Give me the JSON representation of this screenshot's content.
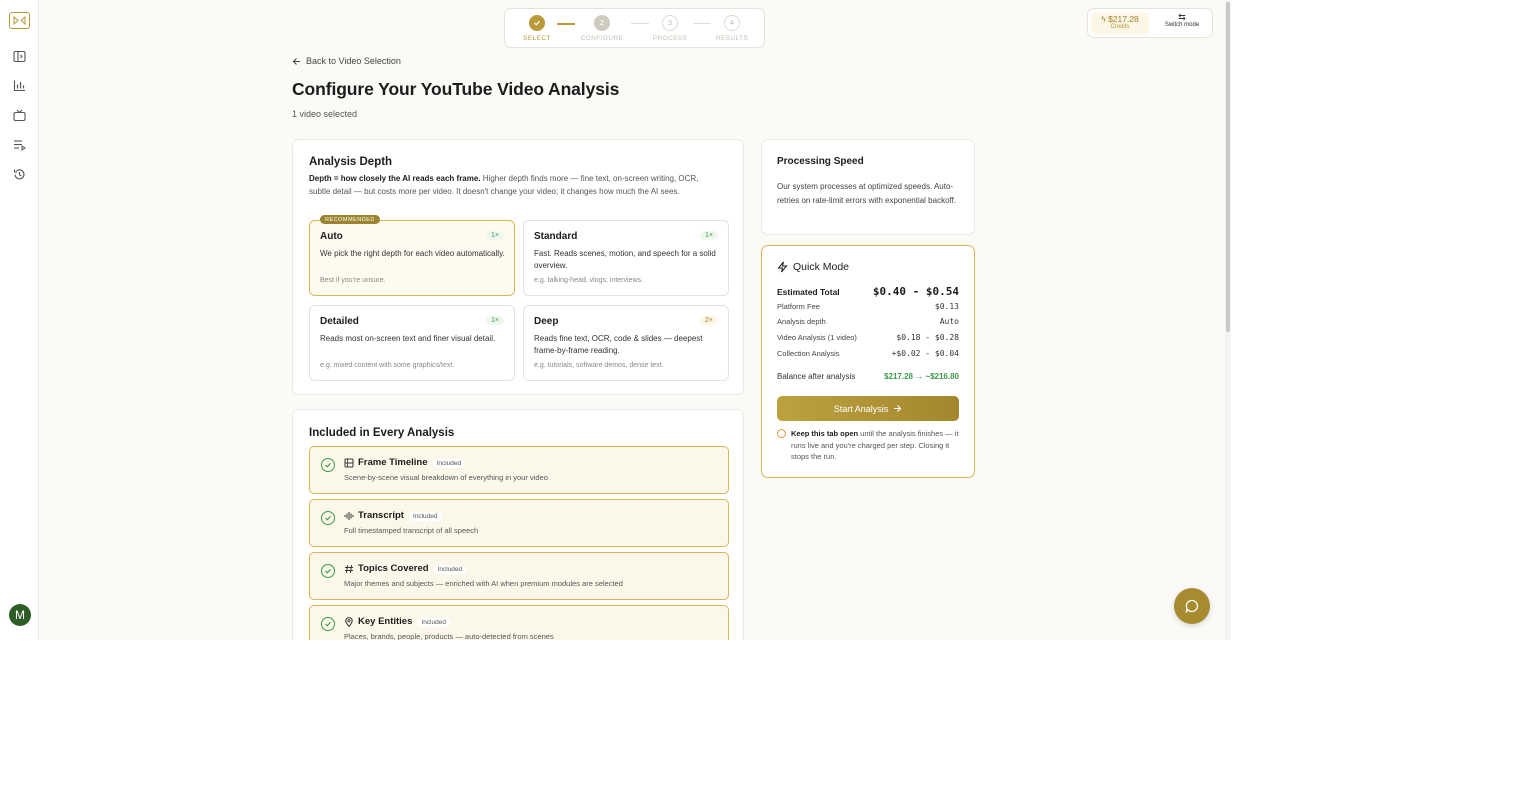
{
  "colors": {
    "accent": "#b99a3a",
    "success": "#3c9a4c",
    "avatar": "#2f5d2a"
  },
  "sidebar": {
    "items": [
      {
        "icon": "panel-icon"
      },
      {
        "icon": "bar-chart-icon"
      },
      {
        "icon": "tv-icon"
      },
      {
        "icon": "playlist-icon"
      },
      {
        "icon": "history-icon"
      }
    ],
    "avatar_initial": "M"
  },
  "stepper": {
    "steps": [
      {
        "number": "✓",
        "label": "SELECT",
        "state": "done"
      },
      {
        "number": "2",
        "label": "CONFIGURE",
        "state": "current"
      },
      {
        "number": "3",
        "label": "PROCESS",
        "state": "pending"
      },
      {
        "number": "4",
        "label": "RESULTS",
        "state": "pending"
      }
    ]
  },
  "credits": {
    "amount": "$217.28",
    "label": "Credits",
    "switch_label": "Switch mode"
  },
  "header": {
    "back_label": "Back to Video Selection",
    "title": "Configure Your YouTube Video Analysis",
    "subtitle": "1 video selected"
  },
  "analysis_depth": {
    "title": "Analysis Depth",
    "desc_bold": "Depth = how closely the AI reads each frame.",
    "desc_rest": " Higher depth finds more — fine text, on-screen writing, OCR, subtle detail — but costs more per video. It doesn't change your video; it changes how much the AI sees.",
    "recommended_badge": "RECOMMENDED",
    "options": [
      {
        "name": "Auto",
        "multiplier": "1×",
        "desc": "We pick the right depth for each video automatically.",
        "example": "Best if you're unsure."
      },
      {
        "name": "Standard",
        "multiplier": "1×",
        "desc": "Fast. Reads scenes, motion, and speech for a solid overview.",
        "example": "e.g. talking-head, vlogs, interviews."
      },
      {
        "name": "Detailed",
        "multiplier": "1×",
        "desc": "Reads most on-screen text and finer visual detail.",
        "example": "e.g. mixed content with some graphics/text."
      },
      {
        "name": "Deep",
        "multiplier": "2×",
        "desc": "Reads fine text, OCR, code & slides — deepest frame-by-frame reading.",
        "example": "e.g. tutorials, software demos, dense text."
      }
    ]
  },
  "included": {
    "title": "Included in Every Analysis",
    "included_tag": "Included",
    "features": [
      {
        "name": "Frame Timeline",
        "desc": "Scene-by-scene visual breakdown of everything in your video",
        "icon": "film-icon"
      },
      {
        "name": "Transcript",
        "desc": "Full timestamped transcript of all speech",
        "icon": "audio-wave-icon"
      },
      {
        "name": "Topics Covered",
        "desc": "Major themes and subjects — enriched with AI when premium modules are selected",
        "icon": "hash-icon"
      },
      {
        "name": "Key Entities",
        "desc": "Places, brands, people, products — auto-detected from scenes",
        "icon": "map-pin-icon"
      }
    ]
  },
  "processing_speed": {
    "title": "Processing Speed",
    "desc": "Our system processes at optimized speeds. Auto-retries on rate-limit errors with exponential backoff."
  },
  "quick_mode": {
    "title": "Quick Mode",
    "estimated_total_label": "Estimated Total",
    "estimated_total": "$0.40 - $0.54",
    "rows": [
      {
        "label": "Platform Fee",
        "value": "$0.13"
      },
      {
        "label": "Analysis depth",
        "value": "Auto"
      },
      {
        "label": "Video Analysis (1 video)",
        "value": "$0.18 - $0.28"
      },
      {
        "label": "Collection Analysis",
        "value": "+$0.02 - $0.04"
      }
    ],
    "balance_label": "Balance after analysis",
    "balance_value": "$217.28 → ~$216.80",
    "start_label": "Start Analysis",
    "keep_bold": "Keep this tab open",
    "keep_rest": " until the analysis finishes — it runs live and you're charged per step. Closing it stops the run."
  }
}
